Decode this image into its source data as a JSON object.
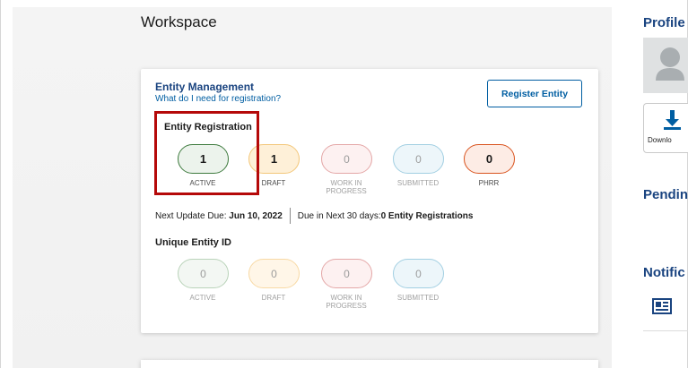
{
  "workspace": {
    "title": "Workspace"
  },
  "entity_management": {
    "title": "Entity Management",
    "help_link": "What do I need for registration?",
    "register_button": "Register Entity",
    "entity_registration": {
      "label": "Entity Registration",
      "statuses": [
        {
          "value": "1",
          "label": "ACTIVE"
        },
        {
          "value": "1",
          "label": "DRAFT"
        },
        {
          "value": "0",
          "label": "WORK IN PROGRESS"
        },
        {
          "value": "0",
          "label": "SUBMITTED"
        },
        {
          "value": "0",
          "label": "PHRR"
        }
      ]
    },
    "next_update_prefix": "Next Update Due: ",
    "next_update_date": "Jun 10, 2022",
    "due_next_prefix": "Due in Next 30 days: ",
    "due_next_value": "0 Entity Registrations",
    "unique_entity_id": {
      "label": "Unique Entity ID",
      "statuses": [
        {
          "value": "0",
          "label": "ACTIVE"
        },
        {
          "value": "0",
          "label": "DRAFT"
        },
        {
          "value": "0",
          "label": "WORK IN PROGRESS"
        },
        {
          "value": "0",
          "label": "SUBMITTED"
        }
      ]
    }
  },
  "sidebar": {
    "profile_title": "Profile",
    "download_label": "Downlo",
    "pending_title": "Pendin",
    "notifications_title": "Notific"
  },
  "colors": {
    "heading_blue": "#1a4480",
    "link_blue": "#005ea2",
    "highlight_red": "#b50909"
  }
}
